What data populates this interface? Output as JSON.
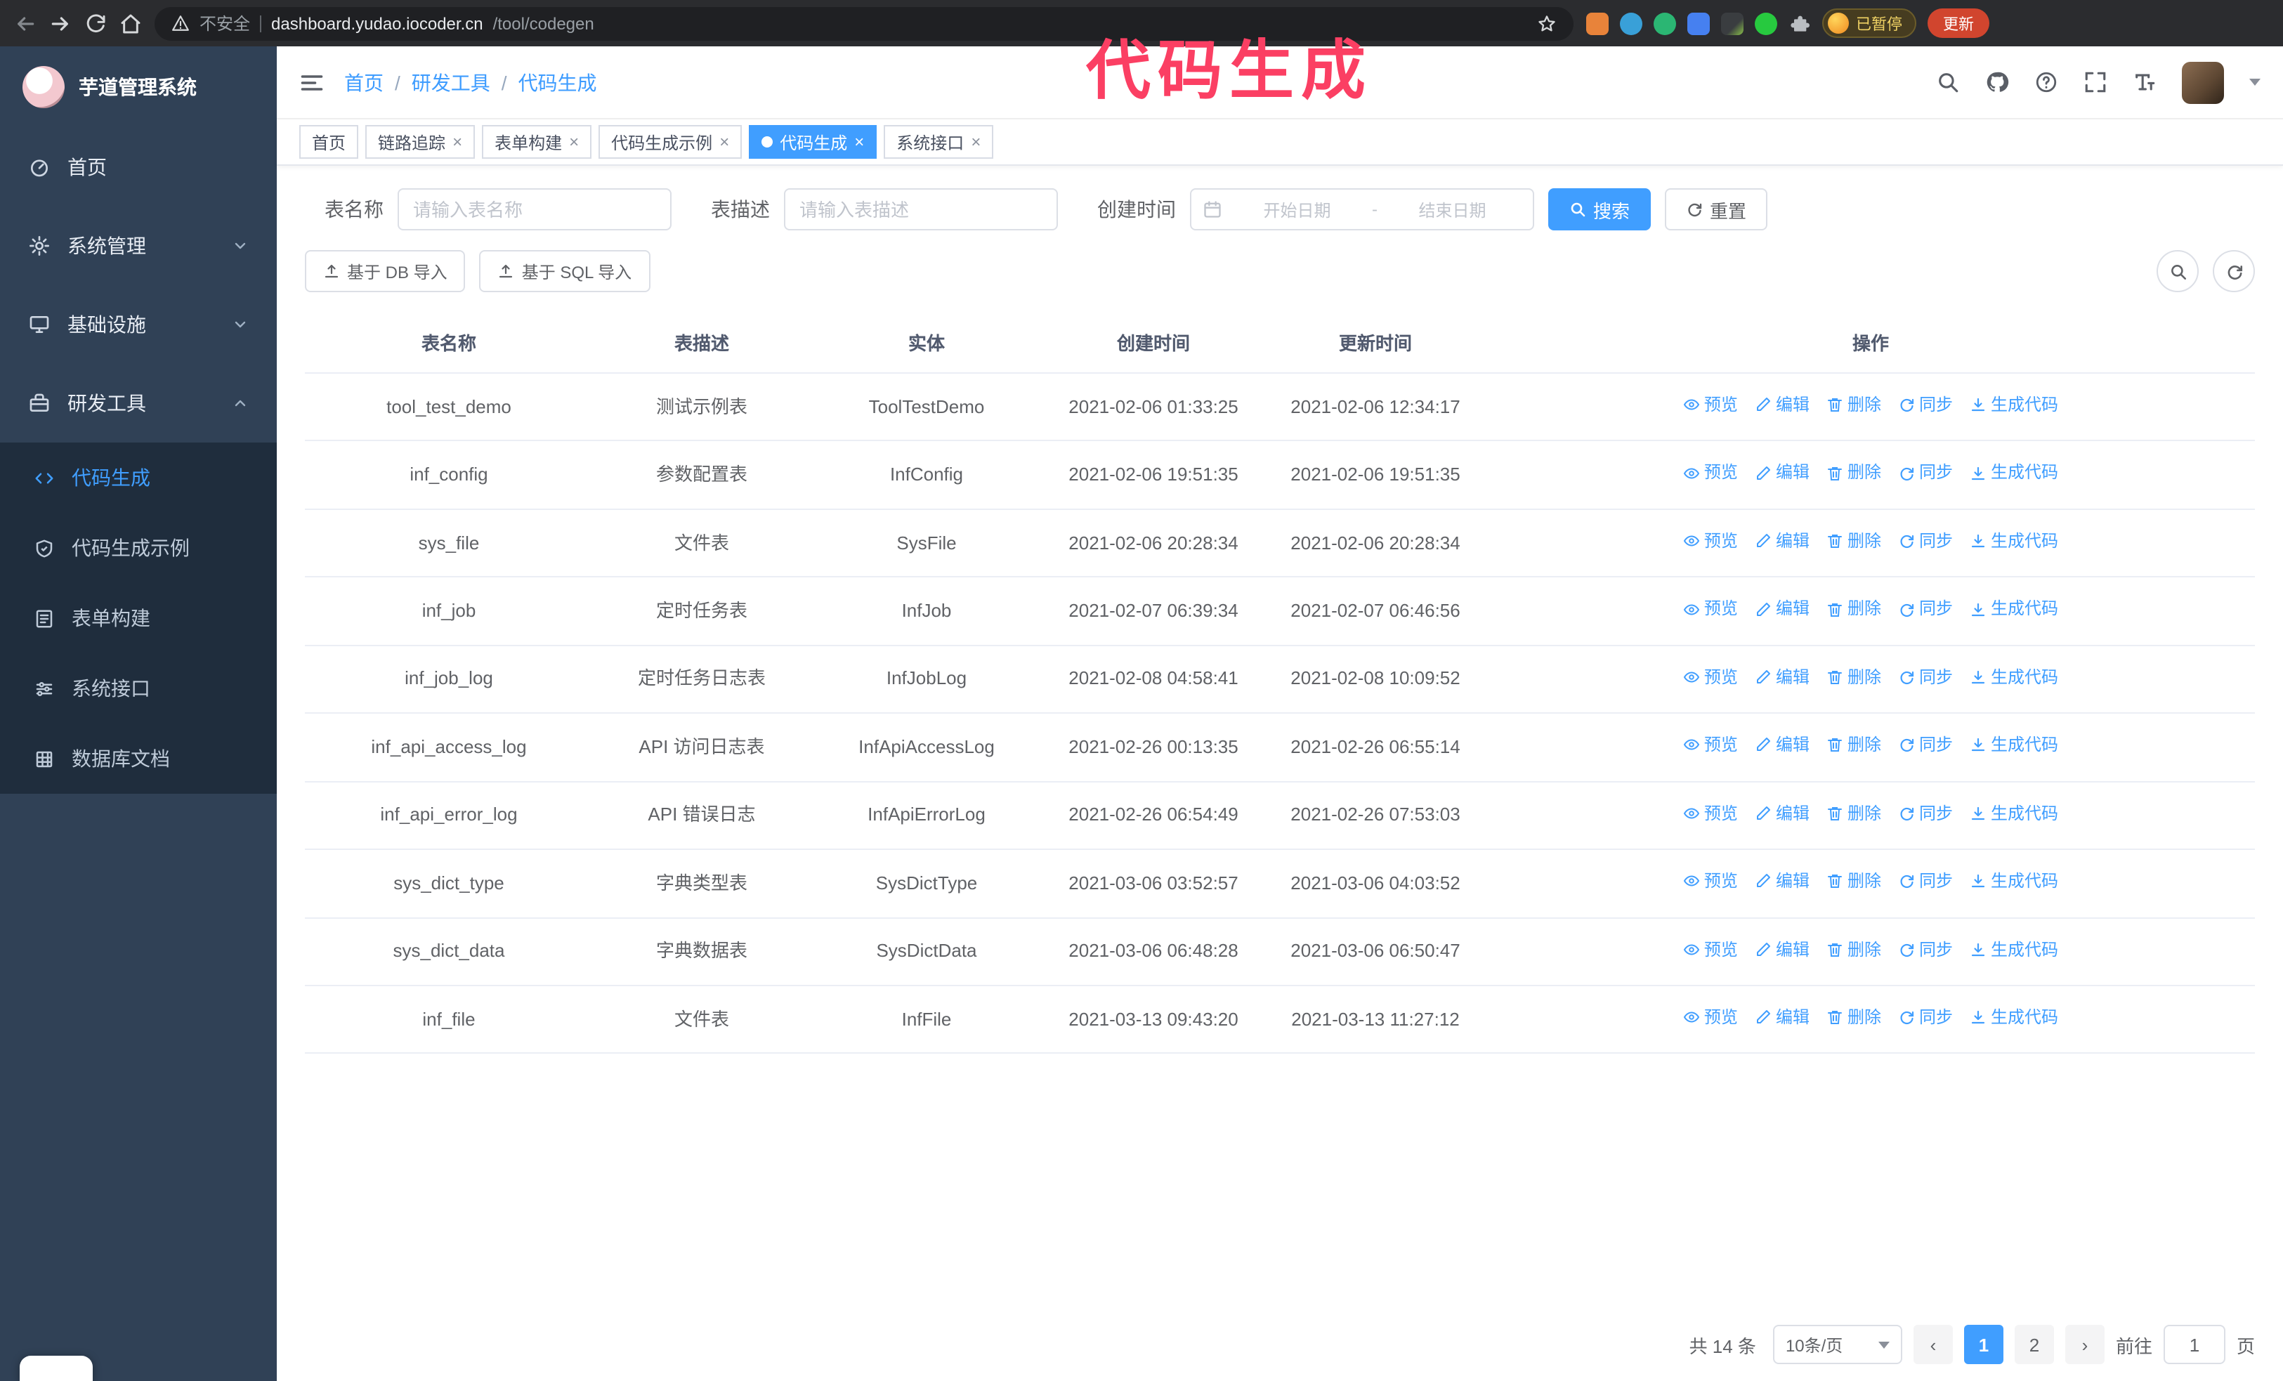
{
  "browser": {
    "security_label": "不安全",
    "url_host": "dashboard.yudao.iocoder.cn",
    "url_path": "/tool/codegen",
    "profile_chip": "已暂停",
    "update_button": "更新"
  },
  "annotation": {
    "text": "代码生成",
    "color": "#fb3f63"
  },
  "sidebar": {
    "logo_title": "芋道管理系统",
    "items": [
      {
        "label": "首页"
      },
      {
        "label": "系统管理"
      },
      {
        "label": "基础设施"
      },
      {
        "label": "研发工具"
      }
    ],
    "sub_items": [
      {
        "label": "代码生成",
        "active": true
      },
      {
        "label": "代码生成示例"
      },
      {
        "label": "表单构建"
      },
      {
        "label": "系统接口"
      },
      {
        "label": "数据库文档"
      }
    ]
  },
  "breadcrumb": [
    "首页",
    "研发工具",
    "代码生成"
  ],
  "tabs": [
    {
      "label": "首页",
      "closable": false,
      "active": false
    },
    {
      "label": "链路追踪",
      "closable": true,
      "active": false
    },
    {
      "label": "表单构建",
      "closable": true,
      "active": false
    },
    {
      "label": "代码生成示例",
      "closable": true,
      "active": false
    },
    {
      "label": "代码生成",
      "closable": true,
      "active": true
    },
    {
      "label": "系统接口",
      "closable": true,
      "active": false
    }
  ],
  "filters": {
    "table_name_label": "表名称",
    "table_name_placeholder": "请输入表名称",
    "table_desc_label": "表描述",
    "table_desc_placeholder": "请输入表描述",
    "create_time_label": "创建时间",
    "date_start_placeholder": "开始日期",
    "date_separator": "-",
    "date_end_placeholder": "结束日期",
    "search_button": "搜索",
    "reset_button": "重置"
  },
  "toolbar": {
    "import_db": "基于 DB 导入",
    "import_sql": "基于 SQL 导入"
  },
  "table": {
    "columns": [
      "表名称",
      "表描述",
      "实体",
      "创建时间",
      "更新时间",
      "操作"
    ],
    "actions": [
      "预览",
      "编辑",
      "删除",
      "同步",
      "生成代码"
    ],
    "rows": [
      {
        "name": "tool_test_demo",
        "desc": "测试示例表",
        "entity": "ToolTestDemo",
        "created": "2021-02-06 01:33:25",
        "updated": "2021-02-06 12:34:17"
      },
      {
        "name": "inf_config",
        "desc": "参数配置表",
        "entity": "InfConfig",
        "created": "2021-02-06 19:51:35",
        "updated": "2021-02-06 19:51:35"
      },
      {
        "name": "sys_file",
        "desc": "文件表",
        "entity": "SysFile",
        "created": "2021-02-06 20:28:34",
        "updated": "2021-02-06 20:28:34"
      },
      {
        "name": "inf_job",
        "desc": "定时任务表",
        "entity": "InfJob",
        "created": "2021-02-07 06:39:34",
        "updated": "2021-02-07 06:46:56"
      },
      {
        "name": "inf_job_log",
        "desc": "定时任务日志表",
        "entity": "InfJobLog",
        "created": "2021-02-08 04:58:41",
        "updated": "2021-02-08 10:09:52"
      },
      {
        "name": "inf_api_access_log",
        "desc": "API 访问日志表",
        "entity": "InfApiAccessLog",
        "created": "2021-02-26 00:13:35",
        "updated": "2021-02-26 06:55:14"
      },
      {
        "name": "inf_api_error_log",
        "desc": "API 错误日志",
        "entity": "InfApiErrorLog",
        "created": "2021-02-26 06:54:49",
        "updated": "2021-02-26 07:53:03"
      },
      {
        "name": "sys_dict_type",
        "desc": "字典类型表",
        "entity": "SysDictType",
        "created": "2021-03-06 03:52:57",
        "updated": "2021-03-06 04:03:52"
      },
      {
        "name": "sys_dict_data",
        "desc": "字典数据表",
        "entity": "SysDictData",
        "created": "2021-03-06 06:48:28",
        "updated": "2021-03-06 06:50:47"
      },
      {
        "name": "inf_file",
        "desc": "文件表",
        "entity": "InfFile",
        "created": "2021-03-13 09:43:20",
        "updated": "2021-03-13 11:27:12"
      }
    ]
  },
  "pagination": {
    "total": "共 14 条",
    "page_size": "10条/页",
    "pages": [
      "1",
      "2"
    ],
    "active_page": "1",
    "goto_label": "前往",
    "goto_value": "1",
    "goto_suffix": "页"
  },
  "colors": {
    "accent": "#409EFF",
    "sidebar_bg": "#304156",
    "submenu_bg": "#1f2d3d",
    "annotation": "#fb3f63"
  },
  "icons": {
    "search": "magnifier",
    "reset": "circular-arrow",
    "import": "upload",
    "preview": "eye",
    "edit": "pencil",
    "delete": "trash",
    "sync": "circular-arrows",
    "generate": "download",
    "date": "calendar",
    "warning": "triangle-exclamation",
    "bookmark": "star",
    "extensions": "puzzle-piece"
  }
}
